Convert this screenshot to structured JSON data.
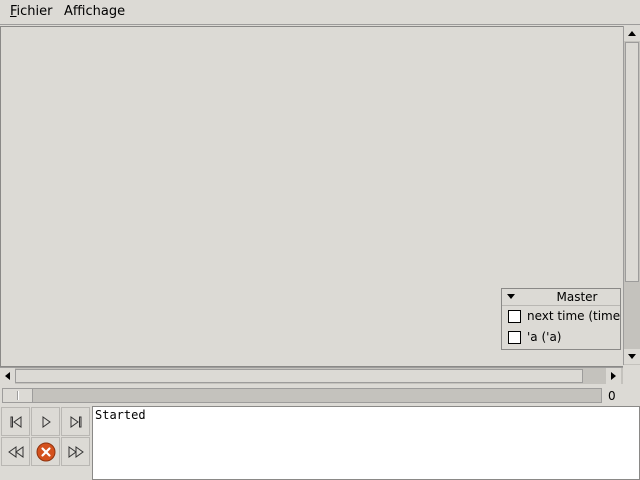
{
  "menubar": {
    "items": [
      {
        "mnemonic": "F",
        "rest": "ichier"
      },
      {
        "pre": "Affichage"
      }
    ]
  },
  "master_panel": {
    "title": "Master",
    "rows": [
      {
        "label": "next time  (time)",
        "checked": false
      },
      {
        "label": "'a  ('a)",
        "checked": false
      }
    ]
  },
  "timeline": {
    "value": "0"
  },
  "log": {
    "text": "Started"
  },
  "colors": {
    "background": "#dcdad5",
    "stop_button": "#d4511d",
    "log_background": "#ffffff"
  },
  "icons": {
    "controls": [
      "skip-to-start-icon",
      "play-icon",
      "step-to-end-icon",
      "fast-rewind-icon",
      "stop-icon",
      "fast-forward-icon"
    ]
  }
}
